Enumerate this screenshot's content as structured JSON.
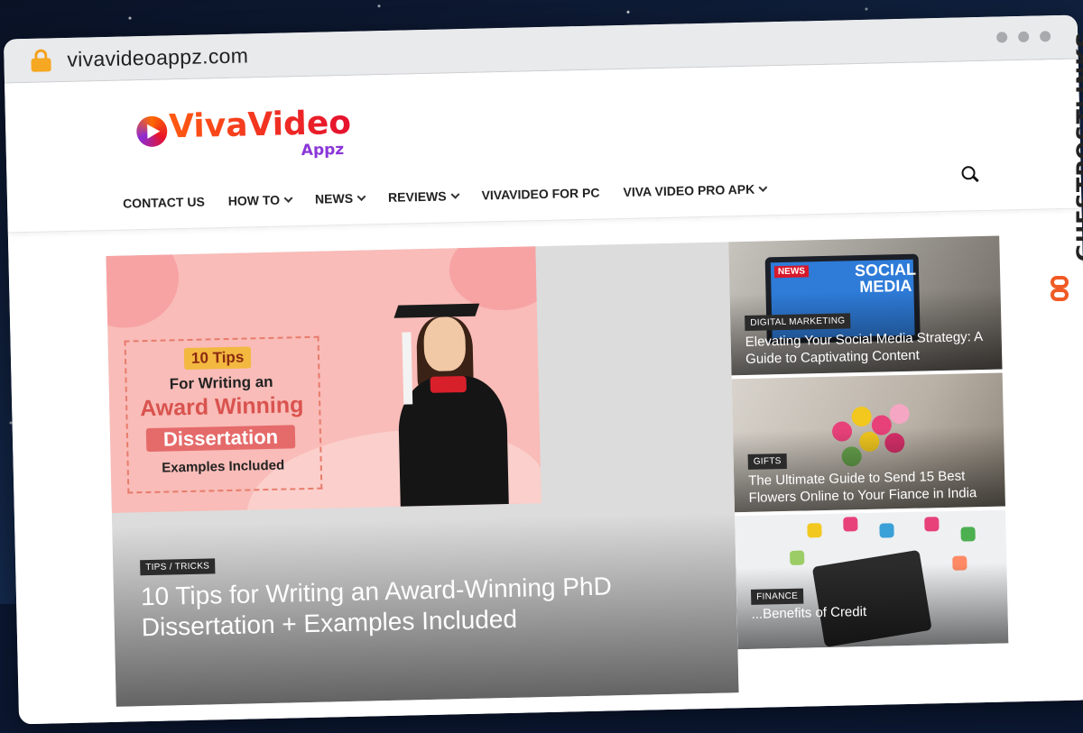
{
  "browser": {
    "url": "vivavideoappz.com"
  },
  "site": {
    "logo": {
      "name": "VivaVideo",
      "sub": "Appz"
    },
    "nav": [
      {
        "label": "CONTACT US",
        "has_dropdown": false
      },
      {
        "label": "HOW TO",
        "has_dropdown": true
      },
      {
        "label": "NEWS",
        "has_dropdown": true
      },
      {
        "label": "REVIEWS",
        "has_dropdown": true
      },
      {
        "label": "VIVAVIDEO FOR PC",
        "has_dropdown": false
      },
      {
        "label": "VIVA VIDEO PRO APK",
        "has_dropdown": true
      }
    ]
  },
  "feature": {
    "promo": {
      "badge": "10 Tips",
      "line1": "For Writing an",
      "line2": "Award Winning",
      "line3": "Dissertation",
      "line4": "Examples Included"
    },
    "tag": "TIPS / TRICKS",
    "title": "10 Tips for Writing an Award-Winning PhD Dissertation + Examples Included"
  },
  "side_posts": [
    {
      "tag": "DIGITAL MARKETING",
      "title": "Elevating Your Social Media Strategy: A Guide to Captivating Content",
      "image_text_a": "NEWS",
      "image_text_b": "SOCIAL MEDIA"
    },
    {
      "tag": "GIFTS",
      "title": "The Ultimate Guide to Send 15 Best Flowers Online to Your Fiance in India"
    },
    {
      "tag": "FINANCE",
      "title": "...Benefits of Credit"
    }
  ],
  "watermark": {
    "text": "GUESTPOSTLINKS"
  },
  "colors": {
    "accent": "#f05a24",
    "tag_bg": "#2b2b2b",
    "logo_orange": "#ff5a12",
    "logo_purple": "#8a36d8"
  }
}
